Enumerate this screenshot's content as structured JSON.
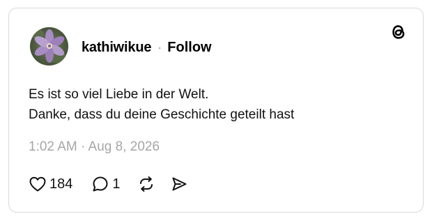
{
  "post": {
    "username": "kathiwikue",
    "separator": "·",
    "follow_label": "Follow",
    "text_lines": [
      "Es ist so viel Liebe in der Welt.",
      "Danke, dass du deine Geschichte geteilt hast"
    ],
    "timestamp": "1:02 AM · Aug 8, 2026",
    "like_count": "184",
    "reply_count": "1"
  },
  "icons": {
    "logo": "threads-logo-icon",
    "like": "heart-icon",
    "reply": "speech-bubble-icon",
    "repost": "repost-icon",
    "share": "send-icon"
  },
  "colors": {
    "text": "#000000",
    "muted": "#a6a6a6",
    "border": "#d9d9d9",
    "avatar_flower": "#9b7fb5"
  }
}
